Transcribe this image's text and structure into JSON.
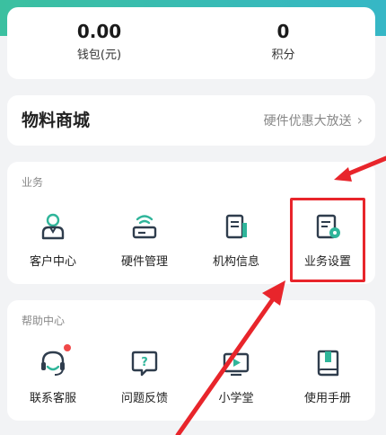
{
  "wallet": {
    "balance_value": "0.00",
    "balance_label": "钱包(元)",
    "points_value": "0",
    "points_label": "积分"
  },
  "mall": {
    "title": "物料商城",
    "link_text": "硬件优惠大放送",
    "chevron": "›"
  },
  "business": {
    "section_title": "业务",
    "items": [
      {
        "label": "客户中心",
        "icon": "customer-center-icon"
      },
      {
        "label": "硬件管理",
        "icon": "hardware-icon"
      },
      {
        "label": "机构信息",
        "icon": "organization-icon"
      },
      {
        "label": "业务设置",
        "icon": "business-settings-icon"
      }
    ]
  },
  "help": {
    "section_title": "帮助中心",
    "items": [
      {
        "label": "联系客服",
        "icon": "customer-service-icon"
      },
      {
        "label": "问题反馈",
        "icon": "feedback-icon"
      },
      {
        "label": "小学堂",
        "icon": "video-classroom-icon"
      },
      {
        "label": "使用手册",
        "icon": "manual-book-icon"
      }
    ]
  },
  "colors": {
    "accent": "#2fb59a",
    "highlight": "#e8252b",
    "badge": "#f04848"
  }
}
